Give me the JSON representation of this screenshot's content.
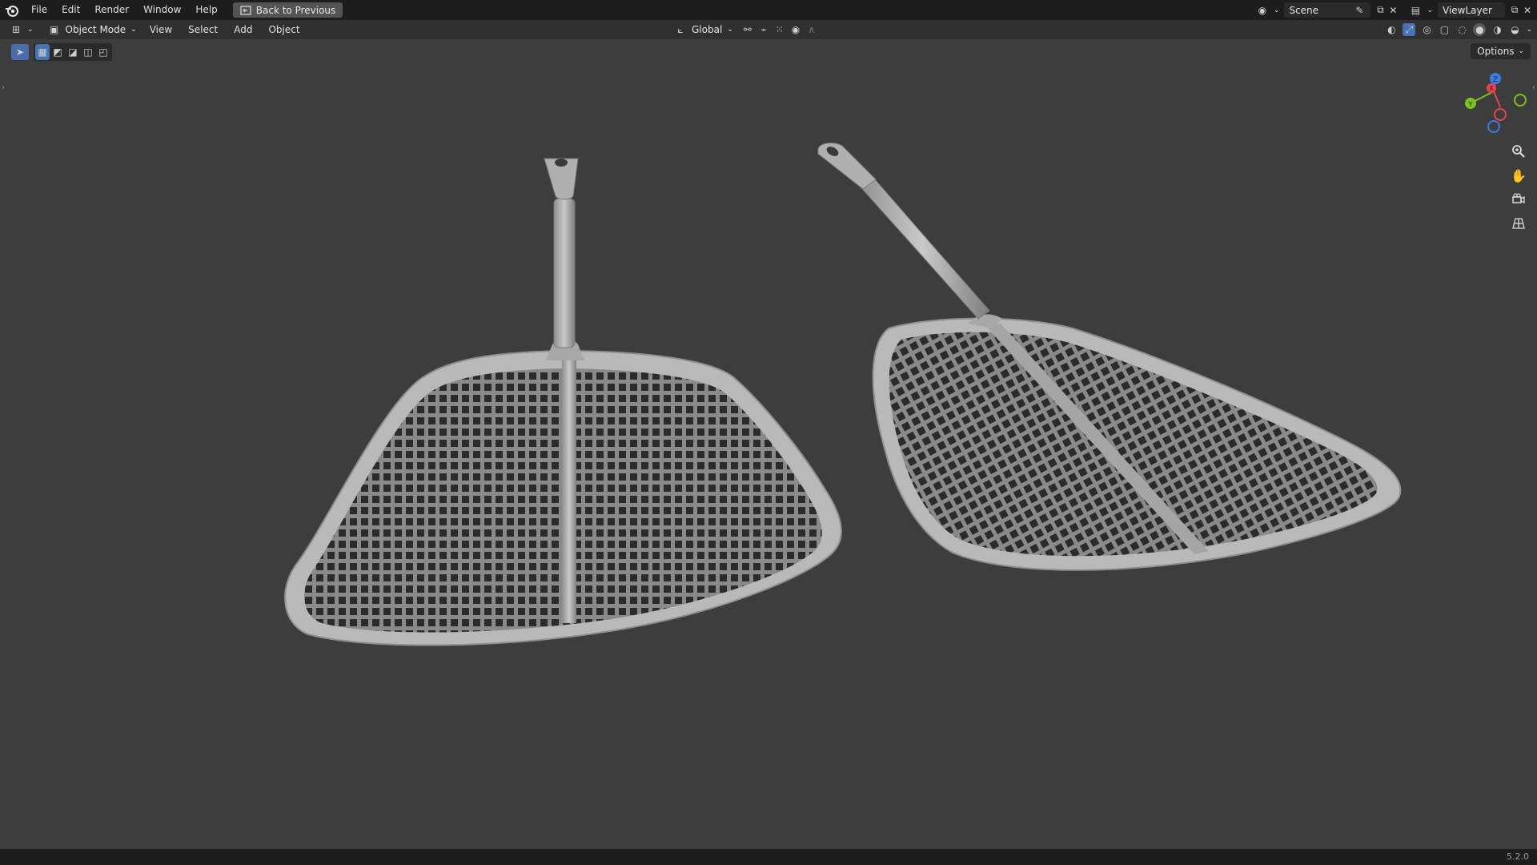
{
  "topbar": {
    "menus": [
      "File",
      "Edit",
      "Render",
      "Window",
      "Help"
    ],
    "back_label": "Back to Previous",
    "scene_name": "Scene",
    "view_layer_name": "ViewLayer"
  },
  "viewport_header": {
    "mode_label": "Object Mode",
    "menus": [
      "View",
      "Select",
      "Add",
      "Object"
    ],
    "transform_orientation": "Global"
  },
  "toolbar": {
    "options_label": "Options"
  },
  "gizmo": {
    "x_label": "X",
    "y_label": "Y",
    "z_label": "Z",
    "x_color": "#e8444d",
    "y_color": "#7dc21e",
    "z_color": "#3a7fe0"
  },
  "statusbar": {
    "version": "5.2.0"
  },
  "colors": {
    "background": "#3d3d3d",
    "topbar": "#1d1d1d",
    "header": "#303030",
    "accent": "#4772b3"
  },
  "icons": {
    "app_logo": "blender-logo-icon",
    "back": "back-icon",
    "zoom": "zoom-icon",
    "pan": "hand-icon",
    "camera": "camera-icon",
    "perspective": "grid-perspective-icon"
  }
}
